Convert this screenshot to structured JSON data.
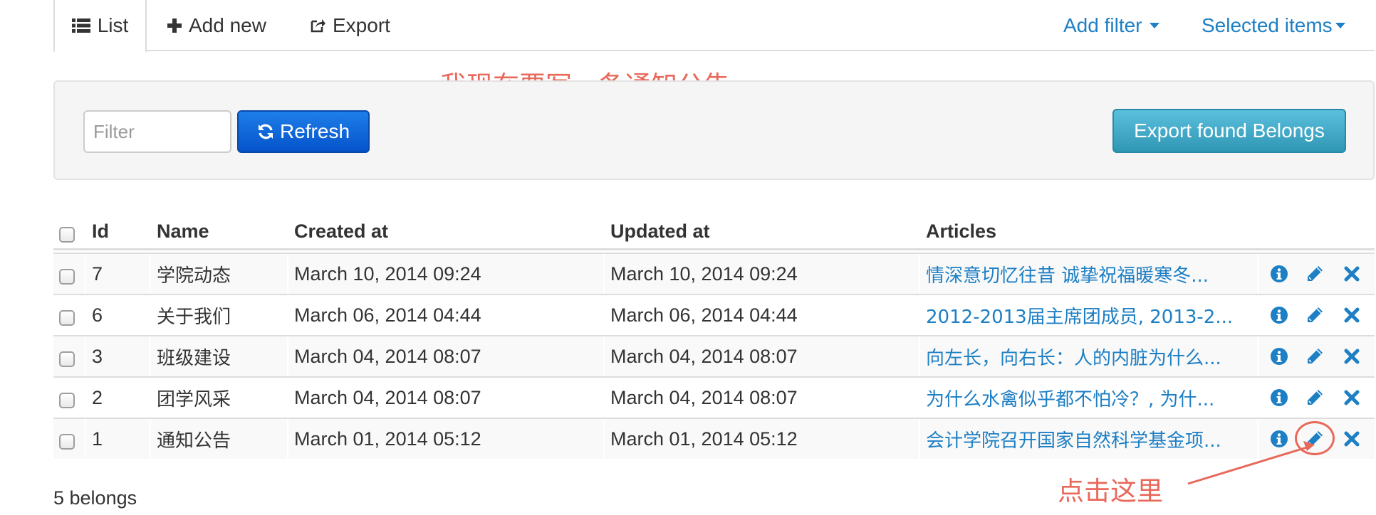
{
  "tabs": {
    "list_label": "List",
    "add_new_label": "Add new",
    "export_label": "Export",
    "add_filter_label": "Add filter",
    "selected_items_label": "Selected items"
  },
  "annotations": {
    "top_note": "我现在要写一条通知公告",
    "click_here": "点击这里"
  },
  "toolbar": {
    "filter_placeholder": "Filter",
    "refresh_label": "Refresh",
    "export_found_label": "Export found Belongs"
  },
  "table": {
    "headers": {
      "id": "Id",
      "name": "Name",
      "created_at": "Created at",
      "updated_at": "Updated at",
      "articles": "Articles"
    },
    "rows": [
      {
        "id": "7",
        "name": "学院动态",
        "created_at": "March 10, 2014 09:24",
        "updated_at": "March 10, 2014 09:24",
        "articles": "情深意切忆往昔 诚挚祝福暖寒冬..."
      },
      {
        "id": "6",
        "name": "关于我们",
        "created_at": "March 06, 2014 04:44",
        "updated_at": "March 06, 2014 04:44",
        "articles": "2012-2013届主席团成员, 2013-2..."
      },
      {
        "id": "3",
        "name": "班级建设",
        "created_at": "March 04, 2014 08:07",
        "updated_at": "March 04, 2014 08:07",
        "articles": "向左长，向右长：人的内脏为什么..."
      },
      {
        "id": "2",
        "name": "团学风采",
        "created_at": "March 04, 2014 08:07",
        "updated_at": "March 04, 2014 08:07",
        "articles": "为什么水禽似乎都不怕冷？, 为什..."
      },
      {
        "id": "1",
        "name": "通知公告",
        "created_at": "March 01, 2014 05:12",
        "updated_at": "March 01, 2014 05:12",
        "articles": "会计学院召开国家自然科学基金项..."
      }
    ]
  },
  "footer": {
    "count_text": "5 belongs"
  },
  "colors": {
    "link": "#1d7fc4",
    "primary_button": "#0553cb",
    "info_button": "#2f96b4",
    "annotation": "#e8685a"
  },
  "icons": {
    "list": "list-icon",
    "add": "plus-icon",
    "export": "share-icon",
    "refresh": "refresh-icon",
    "info": "info-icon",
    "edit": "pencil-icon",
    "delete": "close-icon"
  }
}
